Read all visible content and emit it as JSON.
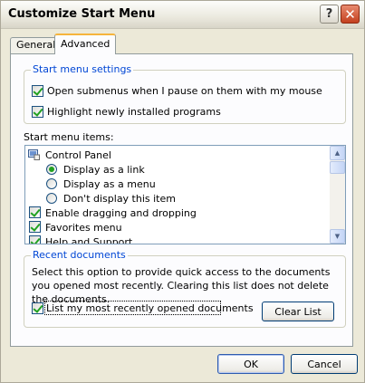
{
  "window": {
    "title": "Customize Start Menu",
    "help_glyph": "?",
    "close_glyph": "✕"
  },
  "tabs": [
    {
      "label": "General"
    },
    {
      "label": "Advanced"
    }
  ],
  "start_menu_settings": {
    "legend": "Start menu settings",
    "options": [
      {
        "label": "Open submenus when I pause on them with my mouse",
        "checked": true
      },
      {
        "label": "Highlight newly installed programs",
        "checked": true
      }
    ]
  },
  "start_menu_items": {
    "label": "Start menu items:",
    "items": [
      {
        "label": "Control Panel",
        "kind": "header",
        "icon": "control-panel-icon"
      },
      {
        "label": "Display as a link",
        "kind": "radio",
        "selected": true
      },
      {
        "label": "Display as a menu",
        "kind": "radio",
        "selected": false
      },
      {
        "label": "Don't display this item",
        "kind": "radio",
        "selected": false
      },
      {
        "label": "Enable dragging and dropping",
        "kind": "checkbox",
        "checked": true
      },
      {
        "label": "Favorites menu",
        "kind": "checkbox",
        "checked": true
      },
      {
        "label": "Help and Support",
        "kind": "checkbox",
        "checked": true
      }
    ],
    "scroll_up_glyph": "▲",
    "scroll_down_glyph": "▼"
  },
  "recent_documents": {
    "legend": "Recent documents",
    "description": "Select this option to provide quick access to the documents you opened most recently.  Clearing this list does not delete the documents.",
    "option": {
      "label": "List my most recently opened documents",
      "checked": true
    },
    "clear_button": "Clear List"
  },
  "footer": {
    "ok": "OK",
    "cancel": "Cancel"
  },
  "colors": {
    "accent_check": "#21a121",
    "legend_text": "#0046d5",
    "tab_highlight": "#f6b43c"
  }
}
